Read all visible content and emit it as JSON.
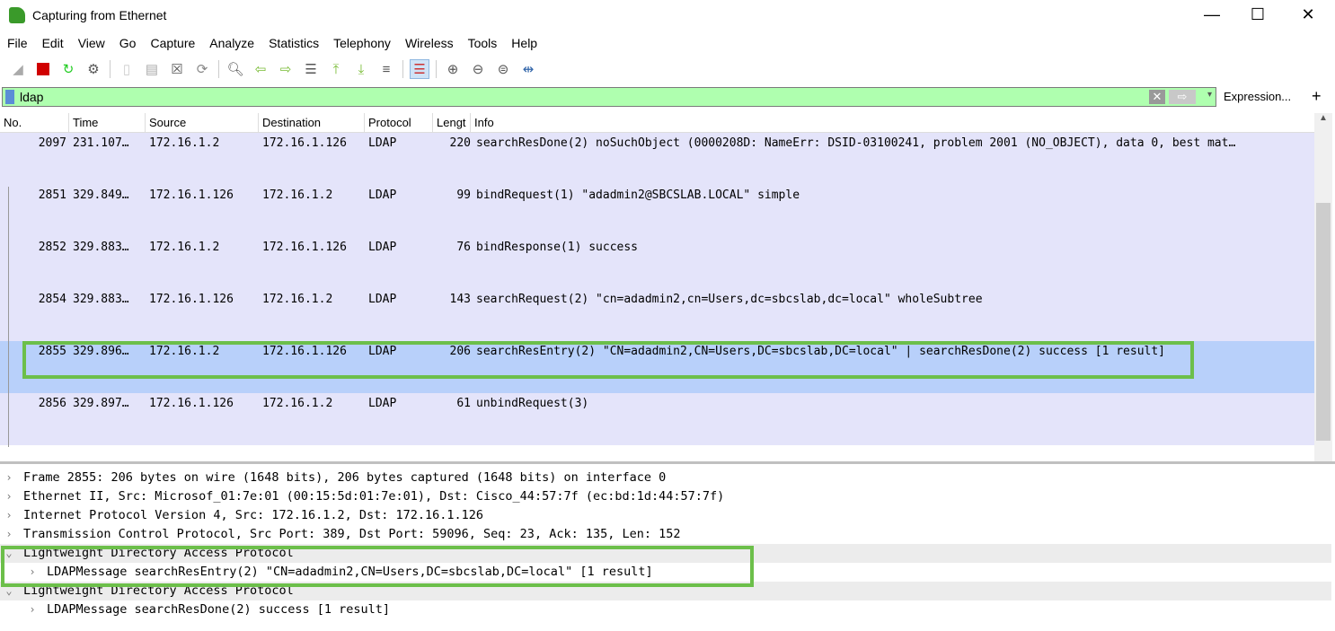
{
  "window": {
    "title": "Capturing from Ethernet",
    "minimize": "—",
    "maximize": "☐",
    "close": "✕"
  },
  "menu": [
    "File",
    "Edit",
    "View",
    "Go",
    "Capture",
    "Analyze",
    "Statistics",
    "Telephony",
    "Wireless",
    "Tools",
    "Help"
  ],
  "toolbar_icons": [
    "shark-fin-start-icon",
    "stop-icon",
    "restart-icon",
    "options-gear-icon",
    "open-file-icon",
    "save-file-icon",
    "close-file-icon",
    "reload-icon",
    "find-icon",
    "back-arrow-icon",
    "forward-arrow-icon",
    "go-to-packet-icon",
    "first-packet-icon",
    "last-packet-icon",
    "auto-scroll-icon",
    "colorize-icon",
    "zoom-in-icon",
    "zoom-out-icon",
    "normal-size-icon",
    "resize-columns-icon"
  ],
  "filter": {
    "value": "ldap",
    "expression_label": "Expression...",
    "add_label": "+",
    "clear": "✕",
    "apply": "⇨",
    "dropdown": "▾"
  },
  "columns": [
    "No.",
    "Time",
    "Source",
    "Destination",
    "Protocol",
    "Lengt",
    "Info"
  ],
  "packets": [
    {
      "no": "2097",
      "time": "231.107…",
      "src": "172.16.1.2",
      "dst": "172.16.1.126",
      "proto": "LDAP",
      "len": "220",
      "info": "searchResDone(2) noSuchObject (0000208D: NameErr: DSID-03100241, problem 2001 (NO_OBJECT), data 0, best mat…"
    },
    {
      "no": "2851",
      "time": "329.849…",
      "src": "172.16.1.126",
      "dst": "172.16.1.2",
      "proto": "LDAP",
      "len": "99",
      "info": "bindRequest(1) \"adadmin2@SBCSLAB.LOCAL\" simple"
    },
    {
      "no": "2852",
      "time": "329.883…",
      "src": "172.16.1.2",
      "dst": "172.16.1.126",
      "proto": "LDAP",
      "len": "76",
      "info": "bindResponse(1) success"
    },
    {
      "no": "2854",
      "time": "329.883…",
      "src": "172.16.1.126",
      "dst": "172.16.1.2",
      "proto": "LDAP",
      "len": "143",
      "info": "searchRequest(2) \"cn=adadmin2,cn=Users,dc=sbcslab,dc=local\" wholeSubtree"
    },
    {
      "no": "2855",
      "time": "329.896…",
      "src": "172.16.1.2",
      "dst": "172.16.1.126",
      "proto": "LDAP",
      "len": "206",
      "info": "searchResEntry(2) \"CN=adadmin2,CN=Users,DC=sbcslab,DC=local\"  | searchResDone(2) success  [1 result]",
      "selected": true
    },
    {
      "no": "2856",
      "time": "329.897…",
      "src": "172.16.1.126",
      "dst": "172.16.1.2",
      "proto": "LDAP",
      "len": "61",
      "info": "unbindRequest(3)"
    }
  ],
  "details": [
    {
      "text": "Frame 2855: 206 bytes on wire (1648 bits), 206 bytes captured (1648 bits) on interface 0",
      "expanded": false,
      "indent": 0
    },
    {
      "text": "Ethernet II, Src: Microsof_01:7e:01 (00:15:5d:01:7e:01), Dst: Cisco_44:57:7f (ec:bd:1d:44:57:7f)",
      "expanded": false,
      "indent": 0
    },
    {
      "text": "Internet Protocol Version 4, Src: 172.16.1.2, Dst: 172.16.1.126",
      "expanded": false,
      "indent": 0
    },
    {
      "text": "Transmission Control Protocol, Src Port: 389, Dst Port: 59096, Seq: 23, Ack: 135, Len: 152",
      "expanded": false,
      "indent": 0
    },
    {
      "text": "Lightweight Directory Access Protocol",
      "expanded": true,
      "indent": 0
    },
    {
      "text": "LDAPMessage searchResEntry(2) \"CN=adadmin2,CN=Users,DC=sbcslab,DC=local\" [1 result]",
      "expanded": false,
      "indent": 1
    },
    {
      "text": "Lightweight Directory Access Protocol",
      "expanded": true,
      "indent": 0
    },
    {
      "text": "LDAPMessage searchResDone(2) success [1 result]",
      "expanded": false,
      "indent": 1
    }
  ],
  "colors": {
    "filter_valid": "#afffaf",
    "row_bg": "#e4e4fa",
    "row_selected": "#b8d0fa",
    "highlight_box": "#6cbf4a"
  }
}
